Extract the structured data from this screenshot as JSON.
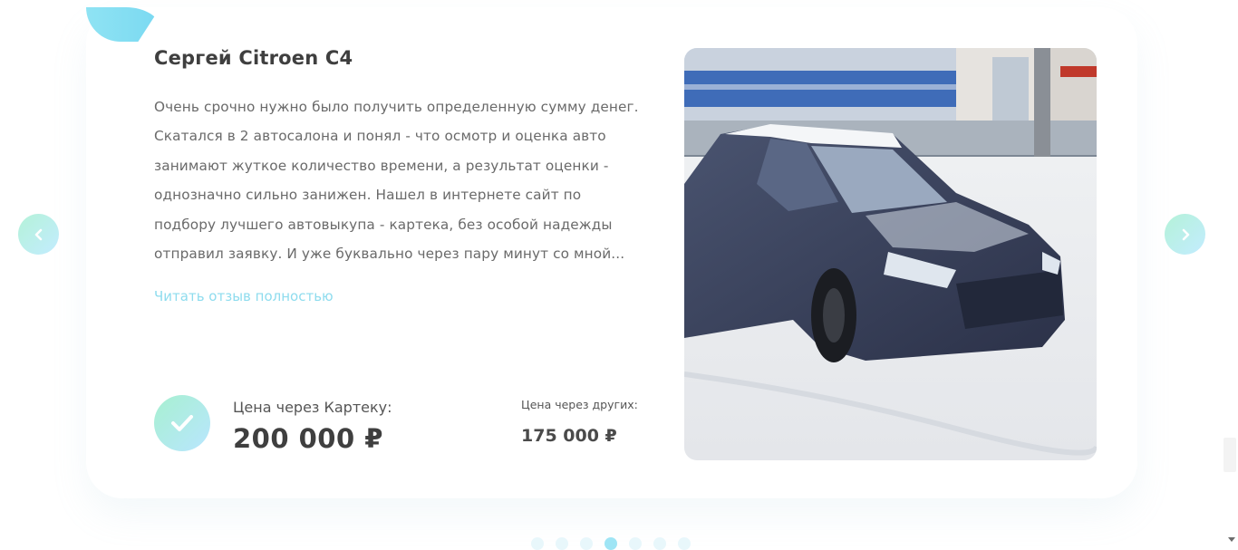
{
  "review": {
    "name": "Сергей Citroen C4",
    "text": "Очень срочно нужно было получить определенную сумму денег. Скатался в 2 автосалона и понял - что осмотр и оценка авто занимают жуткое количество времени, а результат оценки - однозначно сильно занижен. Нашел в интернете сайт по подбору лучшего автовыкупа - картека, без особой надежды отправил заявку. И уже буквально через пару минут со мной...",
    "read_more": "Читать отзыв полностью"
  },
  "prices": {
    "kartek_label": "Цена через Картеку:",
    "kartek_value": "200 000 ₽",
    "others_label": "Цена через других:",
    "others_value": "175 000 ₽"
  },
  "icons": {
    "prev": "chevron-left-icon",
    "next": "chevron-right-icon",
    "check": "check-icon"
  },
  "pagination": {
    "total": 7,
    "active_index": 3
  },
  "colors": {
    "accent": "#8edcee",
    "gradient_start": "#a7f0d0",
    "gradient_end": "#b9e6ff"
  }
}
